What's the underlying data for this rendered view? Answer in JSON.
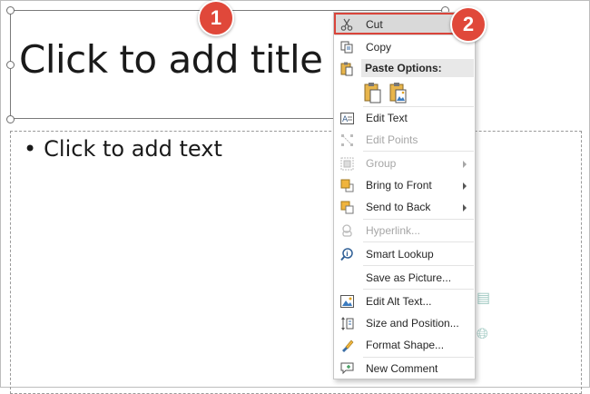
{
  "slide": {
    "title_placeholder": "Click to add title",
    "content_placeholder": "Click to add text",
    "bullet": "•"
  },
  "badges": {
    "first": "1",
    "second": "2"
  },
  "menu": {
    "cut": "Cut",
    "copy": "Copy",
    "paste_options": "Paste Options:",
    "edit_text": "Edit Text",
    "edit_points": "Edit Points",
    "group": "Group",
    "bring_to_front": "Bring to Front",
    "send_to_back": "Send to Back",
    "hyperlink": "Hyperlink...",
    "smart_lookup": "Smart Lookup",
    "save_as_picture": "Save as Picture...",
    "edit_alt_text": "Edit Alt Text...",
    "size_and_position": "Size and Position...",
    "format_shape": "Format Shape...",
    "new_comment": "New Comment"
  },
  "colors": {
    "badge": "#e0483a",
    "highlight_outline": "#d9443a",
    "menu_hover": "#d9d9d9"
  }
}
